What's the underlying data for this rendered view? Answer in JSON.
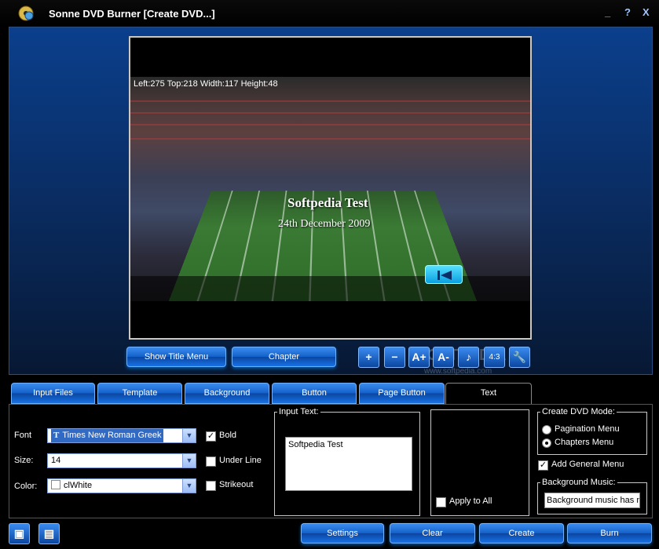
{
  "window": {
    "title": "Sonne DVD Burner [Create DVD...]",
    "controls": [
      "_",
      "?",
      "X"
    ]
  },
  "preview": {
    "position_info": "Left:275   Top:218   Width:117   Height:48",
    "menu_title": "Softpedia Test",
    "menu_date": "24th December 2009"
  },
  "preview_buttons": {
    "show_title_menu": "Show Title Menu",
    "chapter": "Chapter",
    "aspect": "4:3"
  },
  "watermark": {
    "logo": "SOFTPEDIA",
    "url": "www.softpedia.com"
  },
  "tabs": [
    {
      "label": "Input Files"
    },
    {
      "label": "Template"
    },
    {
      "label": "Background"
    },
    {
      "label": "Button"
    },
    {
      "label": "Page Button"
    },
    {
      "label": "Text",
      "active": true
    }
  ],
  "text_panel": {
    "font_label": "Font",
    "font_value": "Times New Roman Greek",
    "size_label": "Size:",
    "size_value": "14",
    "color_label": "Color:",
    "color_value": "clWhite",
    "bold_label": "Bold",
    "bold_checked": true,
    "underline_label": "Under Line",
    "underline_checked": false,
    "strikeout_label": "Strikeout",
    "strikeout_checked": false,
    "input_text_title": "Input Text:",
    "input_text_value": "Softpedia Test",
    "apply_all_label": "Apply to All",
    "apply_all_checked": false
  },
  "dvd_mode": {
    "title": "Create DVD Mode:",
    "pagination_label": "Pagination Menu",
    "chapters_label": "Chapters Menu",
    "selected": "Chapters Menu",
    "add_general_label": "Add General Menu",
    "add_general_checked": true
  },
  "bg_music": {
    "title": "Background Music:",
    "value": "Background music has no"
  },
  "bottom_buttons": {
    "settings": "Settings",
    "clear": "Clear",
    "create": "Create",
    "burn": "Burn"
  },
  "colors": {
    "accent_blue": "#1872e6",
    "panel_bg": "#000000"
  }
}
